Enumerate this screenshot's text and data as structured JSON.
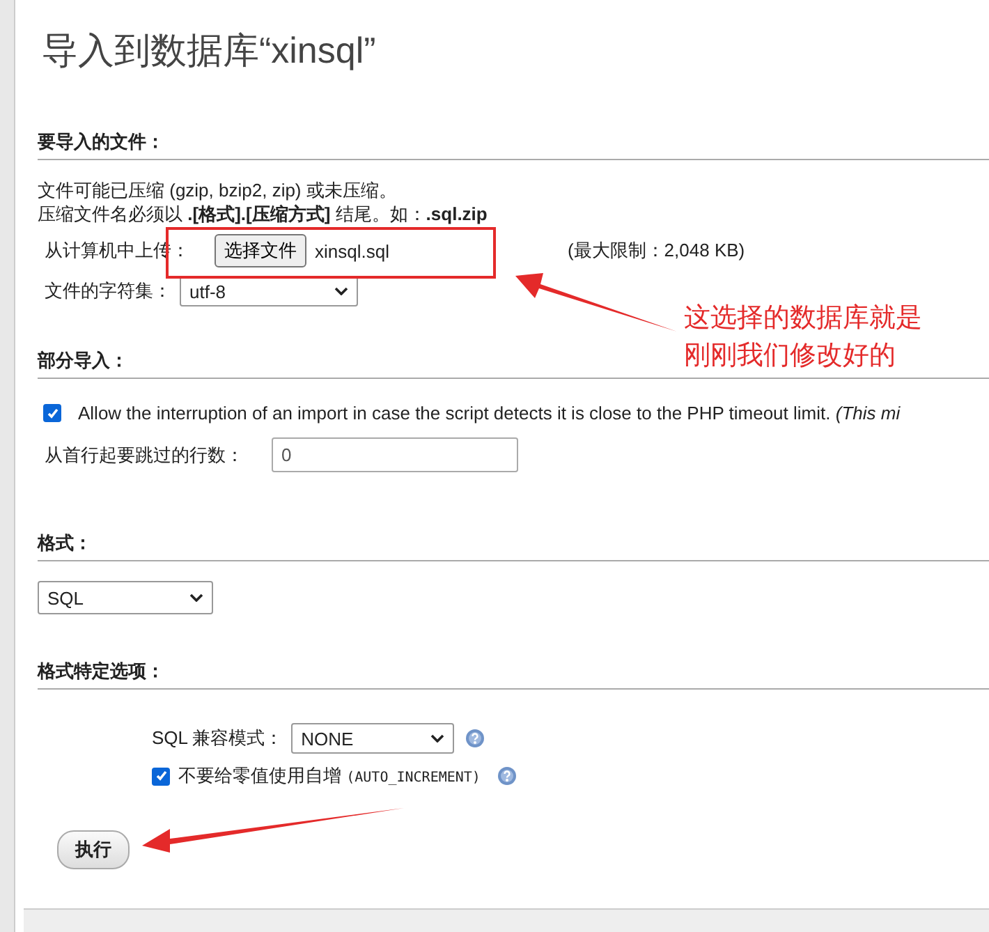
{
  "title": "导入到数据库“xinsql”",
  "file_section": {
    "heading": "要导入的文件：",
    "desc_1": "文件可能已压缩 (gzip, bzip2, zip) 或未压缩。",
    "desc_2": "压缩文件名必须以 **.[格式].[压缩方式]** 结尾。如：**.sql.zip**",
    "upload_label": "从计算机中上传：",
    "choose_button": "选择文件",
    "file_name": "xinsql.sql",
    "limit": "(最大限制：2,048 KB)",
    "charset_label": "文件的字符集：",
    "charset": "utf-8"
  },
  "partial_section": {
    "heading": "部分导入：",
    "allow_interrupt": {
      "checked": true,
      "label": "Allow the interruption of an import in case the script detects it is close to the PHP timeout limit.",
      "note": "(This mi"
    },
    "skip_label": "从首行起要跳过的行数：",
    "skip_value": "0"
  },
  "format_section": {
    "heading": "格式：",
    "format": "SQL"
  },
  "options_section": {
    "heading": "格式特定选项：",
    "compat_label": "SQL 兼容模式：",
    "compat": "NONE",
    "no_auto_zero": {
      "checked": true,
      "label": "不要给零值使用自增",
      "code": "(AUTO_INCREMENT)"
    }
  },
  "submit": "执行",
  "annotation": {
    "line_1": "这选择的数据库就是",
    "line_2": "刚刚我们修改好的"
  }
}
